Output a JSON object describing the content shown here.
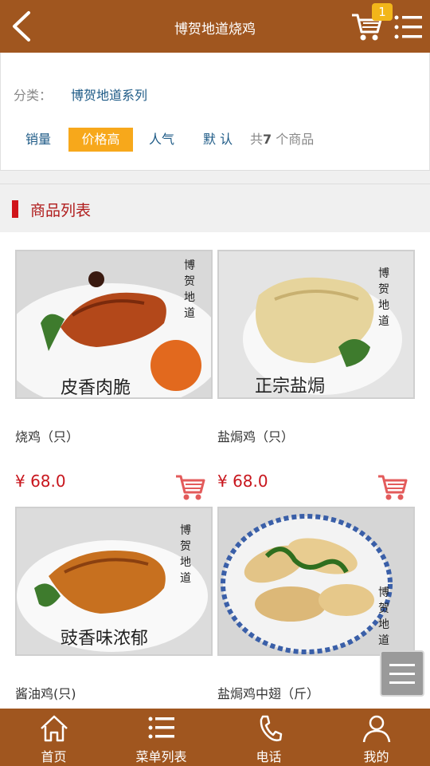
{
  "header": {
    "title": "博贺地道烧鸡",
    "cart_count": "1",
    "back_icon": "chevron-left-icon",
    "cart_icon": "shopping-cart-icon",
    "menu_icon": "list-menu-icon"
  },
  "filter": {
    "category_label": "分类：",
    "category_value": "博贺地道系列",
    "sort_options": [
      "销量",
      "价格高",
      "人气",
      "默 认"
    ],
    "active_sort": "价格高",
    "total_prefix": "共",
    "total_count": "7",
    "total_suffix": " 个商品"
  },
  "section": {
    "title": "商品列表"
  },
  "products": [
    {
      "name": "烧鸡（只）",
      "price": "¥ 68.0",
      "image_text": [
        "博",
        "贺",
        "地",
        "道"
      ],
      "image_caption": "皮香肉脆"
    },
    {
      "name": "盐焗鸡（只）",
      "price": "¥ 68.0",
      "image_text": [
        "博",
        "贺",
        "地",
        "道"
      ],
      "image_caption": "正宗盐焗"
    },
    {
      "name": "酱油鸡(只)",
      "price": "",
      "image_text": [
        "博",
        "贺",
        "地",
        "道"
      ],
      "image_caption": "豉香味浓郁"
    },
    {
      "name": "盐焗鸡中翅（斤）",
      "price": "",
      "image_text": [
        "博",
        "贺",
        "地",
        "道"
      ],
      "image_caption": ""
    }
  ],
  "footer": {
    "tabs": [
      {
        "label": "首页",
        "icon": "home-icon"
      },
      {
        "label": "菜单列表",
        "icon": "list-icon"
      },
      {
        "label": "电话",
        "icon": "phone-icon"
      },
      {
        "label": "我的",
        "icon": "user-icon"
      }
    ]
  },
  "colors": {
    "brand": "#a0561f",
    "accent": "#f7a81b",
    "price": "#c8161d",
    "link": "#1d5a86"
  }
}
